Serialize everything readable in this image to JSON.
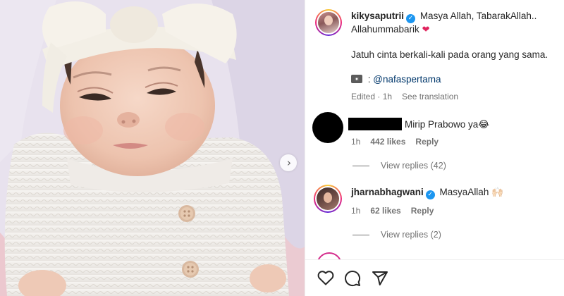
{
  "post": {
    "author": "kikysaputrii",
    "caption_line1": "Masya Allah, TabarakAllah..",
    "caption_line2": "Allahummabarik",
    "caption_body": "Jatuh cinta berkali-kali pada orang yang sama.",
    "photo_credit_prefix": ":",
    "photo_credit_handle": "@nafaspertama",
    "edited": "Edited · 1h",
    "see_translation": "See translation"
  },
  "comments": [
    {
      "username": "",
      "redacted": true,
      "text": "Mirip Prabowo ya😂",
      "time": "1h",
      "likes": "442 likes",
      "reply": "Reply",
      "view_replies": "View replies (42)"
    },
    {
      "username": "jharnabhagwani",
      "verified": true,
      "text": "MasyaAllah 🙌🏻",
      "time": "1h",
      "likes": "62 likes",
      "reply": "Reply",
      "view_replies": "View replies (2)"
    }
  ],
  "icons": [
    "chevron-right-icon",
    "verified-badge-icon",
    "heart-icon",
    "camera-icon",
    "comment-icon",
    "share-icon"
  ],
  "colors": {
    "verified": "#1c96f0",
    "mention": "#00376b",
    "muted": "#737373",
    "heart": "#e0245e"
  }
}
